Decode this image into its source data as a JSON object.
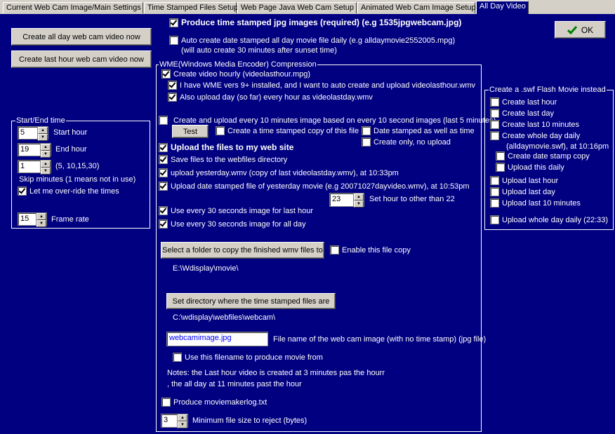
{
  "tabs": [
    "Current Web Cam Image/Main Settings",
    "Time Stamped Files Setup",
    "Web Page Java Web Cam Setup",
    "Animated Web Cam Image Setup",
    "All Day Video"
  ],
  "ok_label": "OK",
  "top": {
    "produce_jpg": "Produce time stamped jpg images (required) (e.g 1535jpgwebcam.jpg)",
    "auto_create_1": "Auto create date stamped all day movie file daily (e.g alldaymovie2552005.mpg)",
    "auto_create_2": "(will auto create 30 minutes after sunset time)"
  },
  "left_buttons": {
    "create_all_day": "Create all day web cam video now",
    "create_last_hour": "Create last hour web cam video now"
  },
  "startend": {
    "title": "Start/End time",
    "start_value": "5",
    "start_label": "Start hour",
    "end_value": "19",
    "end_label": "End hour",
    "skip_value": "1",
    "skip_hint": "(5, 10,15,30)",
    "skip_label": "Skip minutes (1 means not in use)",
    "override_label": "Let me over-ride the times",
    "frame_value": "15",
    "frame_label": "Frame rate"
  },
  "wme": {
    "title": "WME(Windows Media Encoder) Compression",
    "create_hourly": "Create video hourly (videolasthour.mpg)",
    "have_wme": "I have WME vers 9+ installed, and I want to auto create and upload videolasthour.wmv",
    "also_upload": "Also upload day (so far) every hour as videolastday.wmv",
    "create_10min": "Create and upload every 10 minutes image based on every 10 second images (last 5 minutes)",
    "test": "Test",
    "ts_copy": "Create a time stamped copy of this file",
    "date_stamped": "Date stamped as well as time",
    "create_only": "Create only, no upload",
    "upload_files": "Upload the files to my web site",
    "save_files": "Save files to the webfiles directory",
    "upload_yesterday": "upload yesterday.wmv (copy of last videolastday.wmv), at 10:33pm",
    "upload_date_stamped": "Upload date stamped file of yesterday movie (e.g 20071027dayvideo.wmv), at 10:53pm",
    "set_hour_value": "23",
    "set_hour_label": "Set hour to other than 22",
    "use30_hour": "Use every 30 seconds image for last hour",
    "use30_day": "Use every 30 seconds image for all day",
    "select_folder": "Select a folder to copy the finished wmv files to",
    "enable_copy": "Enable this file copy",
    "folder_path": "E:\\Wdisplay\\movie\\",
    "set_dir": "Set directory where the time stamped files are",
    "dir_path": "C:\\wdisplay\\webfiles\\webcam\\",
    "filename_value": "webcamimage.jpg",
    "filename_label": "File name of the web cam image (with no time stamp) (jpg file)",
    "use_filename": "Use this filename to produce movie from",
    "notes_1": "Notes: the Last hour video is created at 3 minutes pas the hourr",
    "notes_2": ", the all day at 11 minutes past the hour",
    "produce_log": "Produce moviemakerlog.txt",
    "minsize_value": "3",
    "minsize_label": "Minimum file size to reject (bytes)"
  },
  "swf": {
    "title": "Create a .swf Flash Movie instead",
    "last_hour": "Create last hour",
    "last_day": "Create last day",
    "last_10": "Create last 10 minutes",
    "whole_day": "Create whole day daily",
    "whole_day_note": "(alldaymovie.swf), at 10:16pm",
    "date_stamp_copy": "Create date stamp copy",
    "upload_daily": "Upload this daily",
    "up_last_hour": "Upload last hour",
    "up_last_day": "Upload last day",
    "up_last_10": "Upload last 10 minutes",
    "up_whole_day": "Upload whole day daily (22:33)"
  }
}
